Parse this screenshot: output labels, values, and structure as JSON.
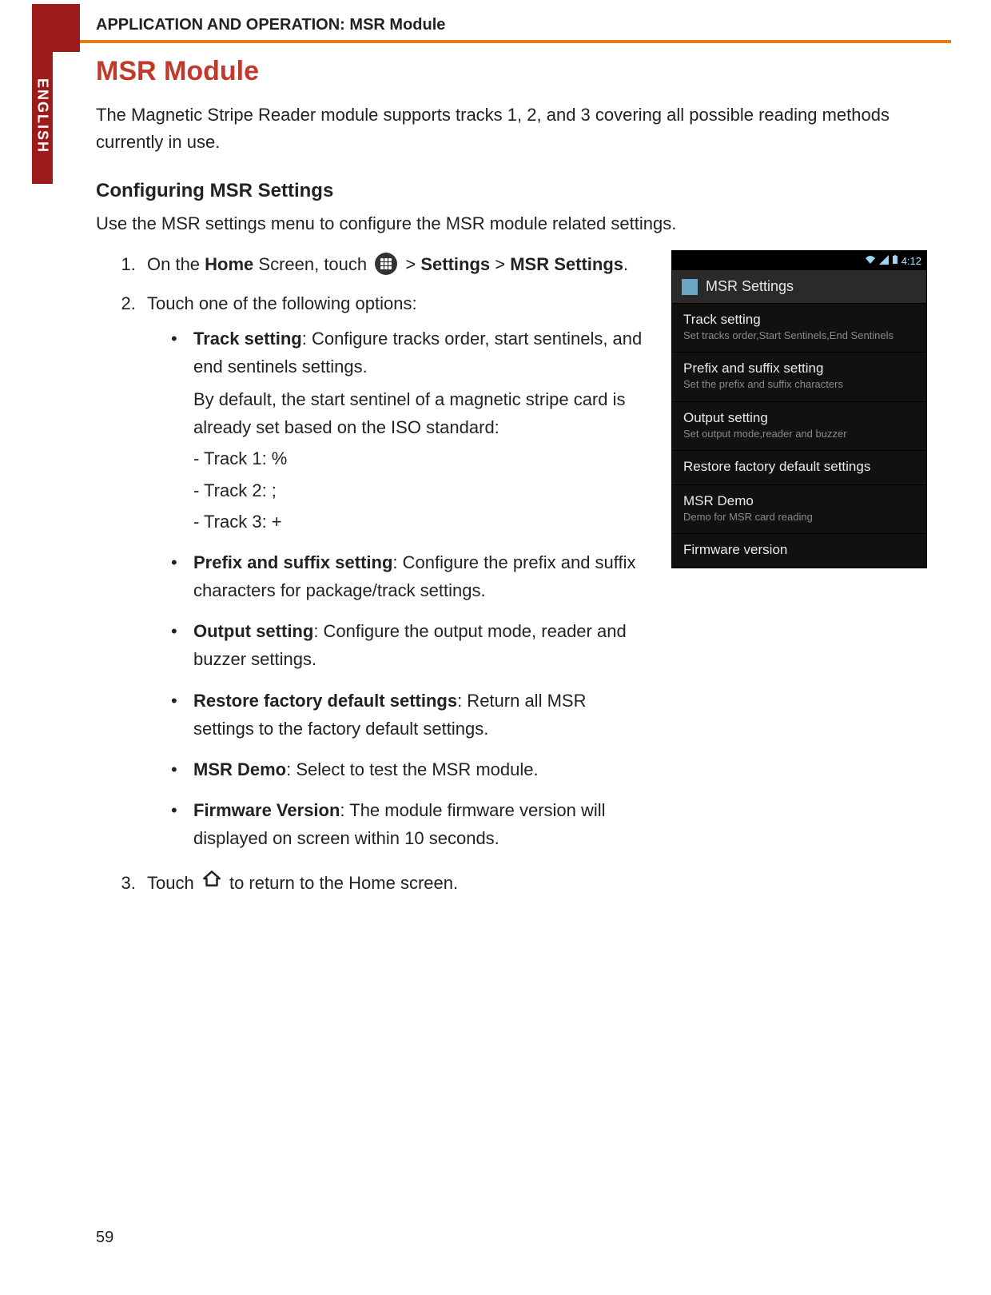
{
  "header": {
    "breadcrumb": "APPLICATION AND OPERATION: MSR Module",
    "side_tab": "ENGLISH",
    "page_number": "59"
  },
  "title": "MSR Module",
  "intro": "The Magnetic Stripe Reader module supports tracks 1, 2, and 3 covering all possible reading methods currently in use.",
  "section": {
    "heading": "Configuring MSR Settings",
    "intro": "Use the MSR settings menu to configure the MSR module related settings."
  },
  "steps": {
    "s1a": "On the ",
    "s1_home": "Home",
    "s1b": " Screen, touch ",
    "s1_arrow1": "   > ",
    "s1_settings": "Settings",
    "s1_arrow2": " > ",
    "s1_msr": "MSR Settings",
    "s1_end": ".",
    "s2": "Touch one of the following options:",
    "s3a": "Touch ",
    "s3b": " to return to the Home screen."
  },
  "options": {
    "track": {
      "label": "Track setting",
      "desc": ": Configure tracks order, start sentinels, and end sentinels settings.",
      "note": "By default, the start sentinel of a magnetic stripe card is already set based on the ISO standard:",
      "t1": "- Track 1: %",
      "t2": "- Track 2: ;",
      "t3": "- Track 3: +"
    },
    "prefix": {
      "label": "Prefix and suffix setting",
      "desc": ": Configure the prefix and suffix characters for package/track settings."
    },
    "output": {
      "label": "Output setting",
      "desc": ": Configure the output mode, reader and buzzer settings."
    },
    "restore": {
      "label": "Restore factory default settings",
      "desc": ": Return all MSR settings to the factory default settings."
    },
    "demo": {
      "label": "MSR Demo",
      "desc": ": Select to test the MSR module."
    },
    "fw": {
      "label": "Firmware Version",
      "desc": ": The module firmware version will displayed on screen within 10 seconds."
    }
  },
  "phone": {
    "time": "4:12",
    "app_title": "MSR Settings",
    "items": [
      {
        "title": "Track setting",
        "sub": "Set tracks order,Start Sentinels,End Sentinels"
      },
      {
        "title": "Prefix and suffix setting",
        "sub": "Set the prefix and suffix characters"
      },
      {
        "title": "Output setting",
        "sub": "Set output mode,reader and buzzer"
      },
      {
        "title": "Restore factory default settings",
        "sub": ""
      },
      {
        "title": "MSR Demo",
        "sub": "Demo for MSR card reading"
      },
      {
        "title": "Firmware version",
        "sub": ""
      }
    ]
  }
}
